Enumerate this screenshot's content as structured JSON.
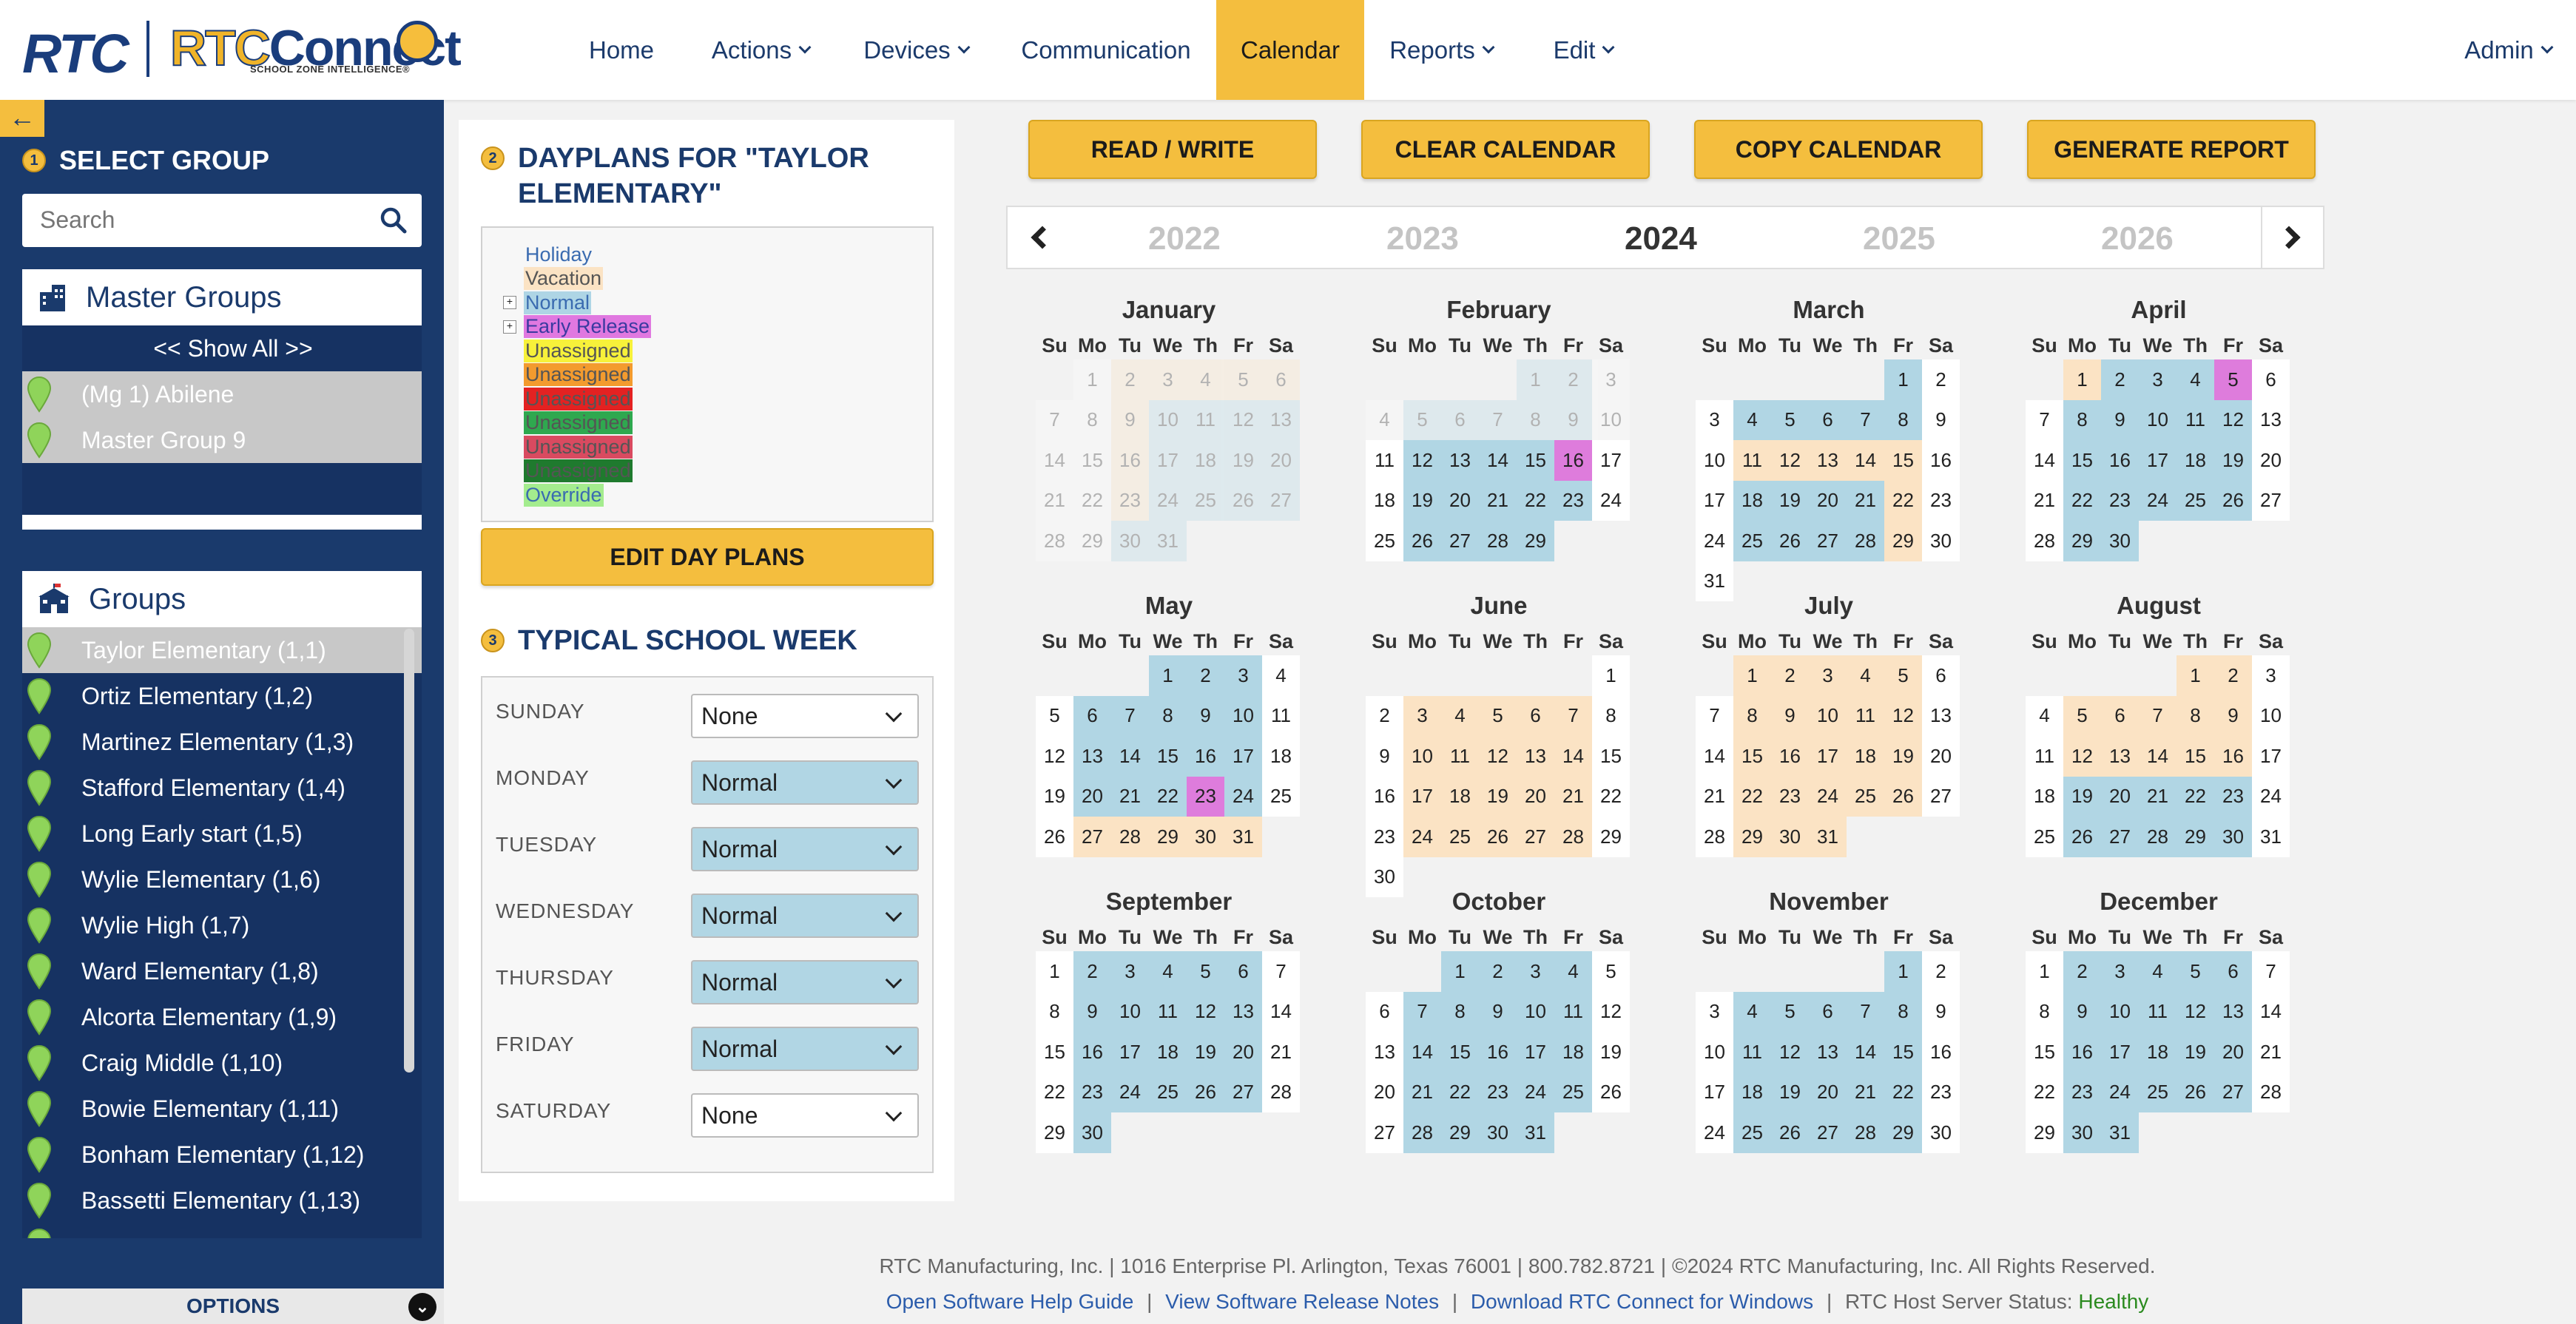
{
  "header": {
    "logo_rtc": "RTC",
    "logo_connect_a": "RTC",
    "logo_connect_b": "Connect",
    "logo_tagline": "SCHOOL ZONE INTELLIGENCE®",
    "nav": [
      {
        "label": "Home"
      },
      {
        "label": "Actions"
      },
      {
        "label": "Devices"
      },
      {
        "label": "Communication"
      },
      {
        "label": "Calendar",
        "active": true
      },
      {
        "label": "Reports"
      },
      {
        "label": "Edit"
      }
    ],
    "user": "Admin"
  },
  "sidebar": {
    "toggle_icon": "←",
    "step": "1",
    "title": "SELECT GROUP",
    "search_placeholder": "Search",
    "master_groups_title": "Master Groups",
    "master_items": [
      {
        "label": "<< Show All >>",
        "selected": false
      },
      {
        "label": "(Mg 1) Abilene",
        "selected": true
      },
      {
        "label": "Master Group 9",
        "selected": true
      }
    ],
    "groups_title": "Groups",
    "groups": [
      {
        "label": "Taylor Elementary (1,1)",
        "selected": true
      },
      {
        "label": "Ortiz Elementary (1,2)"
      },
      {
        "label": "Martinez Elementary (1,3)"
      },
      {
        "label": "Stafford Elementary (1,4)"
      },
      {
        "label": "Long Early start (1,5)"
      },
      {
        "label": "Wylie Elementary (1,6)"
      },
      {
        "label": "Wylie High (1,7)"
      },
      {
        "label": "Ward Elementary (1,8)"
      },
      {
        "label": "Alcorta Elementary (1,9)"
      },
      {
        "label": "Craig Middle (1,10)"
      },
      {
        "label": "Bowie Elementary (1,11)"
      },
      {
        "label": "Bonham Elementary (1,12)"
      },
      {
        "label": "Bassetti Elementary (1,13)"
      }
    ],
    "options_label": "OPTIONS",
    "pin_color": "#8fd45a"
  },
  "dayplans": {
    "step": "2",
    "title": "DAYPLANS FOR \"TAYLOR ELEMENTARY\"",
    "legend": [
      {
        "label": "Holiday",
        "bg": "transparent",
        "fg": "#3a6bb0",
        "expand": false
      },
      {
        "label": "Vacation",
        "bg": "#fbe3c4",
        "fg": "#555",
        "expand": false
      },
      {
        "label": "Normal",
        "bg": "#aed5e5",
        "fg": "#3a6bb0",
        "expand": true
      },
      {
        "label": "Early Release",
        "bg": "#e078e0",
        "fg": "#3a3aa0",
        "expand": true
      },
      {
        "label": "Unassigned",
        "bg": "#f7f13a",
        "fg": "#555",
        "expand": false
      },
      {
        "label": "Unassigned",
        "bg": "#f39b2e",
        "fg": "#555",
        "expand": false
      },
      {
        "label": "Unassigned",
        "bg": "#e32222",
        "fg": "#555",
        "expand": false
      },
      {
        "label": "Unassigned",
        "bg": "#2fa84f",
        "fg": "#555",
        "expand": false
      },
      {
        "label": "Unassigned",
        "bg": "#d94a60",
        "fg": "#555",
        "expand": false
      },
      {
        "label": "Unassigned",
        "bg": "#1f7a2e",
        "fg": "#555",
        "expand": false
      },
      {
        "label": "Override",
        "bg": "#a4ec8e",
        "fg": "#3a6bb0",
        "expand": false
      }
    ],
    "edit_button": "EDIT DAY PLANS"
  },
  "week": {
    "step": "3",
    "title": "TYPICAL SCHOOL WEEK",
    "days": [
      {
        "day": "SUNDAY",
        "value": "None"
      },
      {
        "day": "MONDAY",
        "value": "Normal"
      },
      {
        "day": "TUESDAY",
        "value": "Normal"
      },
      {
        "day": "WEDNESDAY",
        "value": "Normal"
      },
      {
        "day": "THURSDAY",
        "value": "Normal"
      },
      {
        "day": "FRIDAY",
        "value": "Normal"
      },
      {
        "day": "SATURDAY",
        "value": "None"
      }
    ]
  },
  "toolbar": {
    "buttons": [
      "READ / WRITE",
      "CLEAR CALENDAR",
      "COPY CALENDAR",
      "GENERATE REPORT"
    ]
  },
  "calendar": {
    "years": [
      "2022",
      "2023",
      "2024",
      "2025",
      "2026"
    ],
    "current_year": "2024",
    "weekday_headers": [
      "Su",
      "Mo",
      "Tu",
      "We",
      "Th",
      "Fr",
      "Sa"
    ],
    "colors": {
      "N": "#b1d6e4",
      "V": "#fbe3c4",
      "E": "#de7cdc",
      "W": "#ffffff"
    },
    "months": [
      {
        "name": "January",
        "start": 1,
        "days": 31,
        "faded": true,
        "codes": "WVVVVVW WVNNNNW WVNNNNW WVNNNNW WNNN"
      },
      {
        "name": "February",
        "start": 4,
        "days": 29,
        "faded_until": 10,
        "codes": "NNW WNNNNNW WNNNNEW WNNNNNW WNNNN"
      },
      {
        "name": "March",
        "start": 5,
        "days": 31,
        "codes": "NW WNNNNNW WVVVVVW WNNNNVW WNNNNVW W"
      },
      {
        "name": "April",
        "start": 1,
        "days": 30,
        "codes": "VNNNEW WNNNNNW WNNNNNW WNNNNNW WNN"
      },
      {
        "name": "May",
        "start": 3,
        "days": 31,
        "codes": "NNNW WNNNNNW WNNNNNW WNNNENW WVVVVV"
      },
      {
        "name": "June",
        "start": 6,
        "days": 30,
        "codes": "W WVVVVVW WVVVVVW WVVVVVW WVVVVVW W"
      },
      {
        "name": "July",
        "start": 1,
        "days": 31,
        "codes": "VVVVVW WVVVVVW WVVVVVW WVVVVVW WVVV"
      },
      {
        "name": "August",
        "start": 4,
        "days": 31,
        "codes": "VVW WVVVVVW WVVVVVW WNNNNNW WNNNNNW"
      },
      {
        "name": "September",
        "start": 0,
        "days": 30,
        "codes": "WNNNNNW WNNNNNW WNNNNNW WNNNNNW WN"
      },
      {
        "name": "October",
        "start": 2,
        "days": 31,
        "codes": "NNNNW WNNNNNW WNNNNNW WNNNNNW WNNNN"
      },
      {
        "name": "November",
        "start": 5,
        "days": 30,
        "codes": "NW WNNNNNW WNNNNNW WNNNNNW WNNNNNW"
      },
      {
        "name": "December",
        "start": 0,
        "days": 31,
        "codes": "WNNNNNW WNNNNNW WNNNNNW WNNNNNW WNN"
      }
    ]
  },
  "footer": {
    "line1": "RTC Manufacturing, Inc. | 1016 Enterprise Pl. Arlington, Texas 76001 | 800.782.8721 | ©2024 RTC Manufacturing, Inc. All Rights Reserved.",
    "help_link": "Open Software Help Guide",
    "notes_link": "View Software Release Notes",
    "download_link": "Download RTC Connect for Windows",
    "status_label": "RTC Host Server Status:",
    "status_value": "Healthy",
    "sep": "|"
  }
}
